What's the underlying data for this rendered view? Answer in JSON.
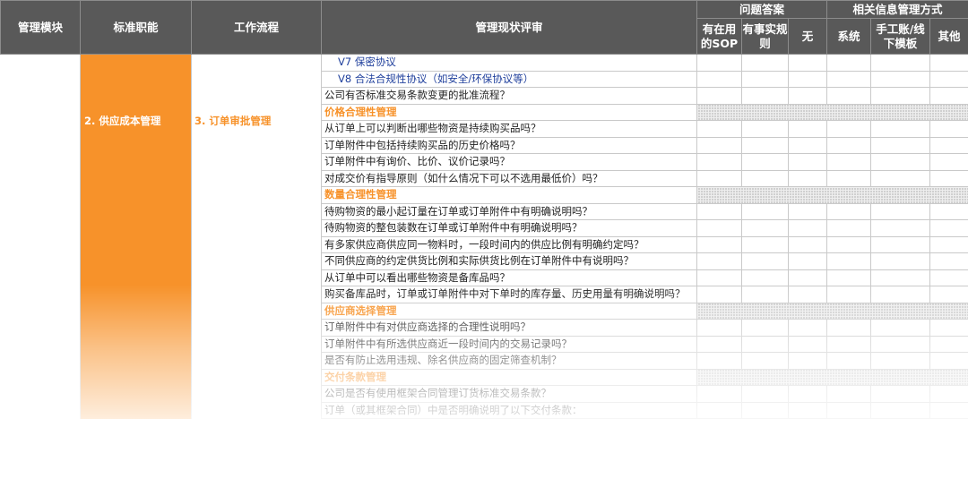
{
  "headers": {
    "module": "管理模块",
    "function": "标准职能",
    "workflow": "工作流程",
    "review": "管理现状评审",
    "answer_group": "问题答案",
    "sop": "有在用的SOP",
    "practical": "有事实规则",
    "none": "无",
    "info_group": "相关信息管理方式",
    "system": "系统",
    "manual": "手工账/线下模板",
    "other": "其他"
  },
  "body": {
    "function_label": "2. 供应成本管理",
    "workflow_label": "3. 订单审批管理"
  },
  "rows": [
    {
      "text": "V7 保密协议",
      "kind": "blue"
    },
    {
      "text": "V8 合法合规性协议（如安全/环保协议等）",
      "kind": "blue"
    },
    {
      "text": "公司有否标准交易条款变更的批准流程？",
      "kind": "item"
    },
    {
      "text": "价格合理性管理",
      "kind": "section"
    },
    {
      "text": "从订单上可以判断出哪些物资是持续购买品吗？",
      "kind": "item"
    },
    {
      "text": "订单附件中包括持续购买品的历史价格吗？",
      "kind": "item"
    },
    {
      "text": "订单附件中有询价、比价、议价记录吗？",
      "kind": "item"
    },
    {
      "text": "对成交价有指导原则（如什么情况下可以不选用最低价）吗？",
      "kind": "item"
    },
    {
      "text": "数量合理性管理",
      "kind": "section"
    },
    {
      "text": "待购物资的最小起订量在订单或订单附件中有明确说明吗？",
      "kind": "item"
    },
    {
      "text": "待购物资的整包装数在订单或订单附件中有明确说明吗？",
      "kind": "item"
    },
    {
      "text": "有多家供应商供应同一物料时，一段时间内的供应比例有明确约定吗？",
      "kind": "item"
    },
    {
      "text": "不同供应商的约定供货比例和实际供货比例在订单附件中有说明吗？",
      "kind": "item"
    },
    {
      "text": "从订单中可以看出哪些物资是备库品吗？",
      "kind": "item"
    },
    {
      "text": "购买备库品时，订单或订单附件中对下单时的库存量、历史用量有明确说明吗？",
      "kind": "wrap"
    },
    {
      "text": "供应商选择管理",
      "kind": "section"
    },
    {
      "text": "订单附件中有对供应商选择的合理性说明吗？",
      "kind": "item"
    },
    {
      "text": "订单附件中有所选供应商近一段时间内的交易记录吗？",
      "kind": "item"
    },
    {
      "text": "是否有防止选用违规、除名供应商的固定筛查机制？",
      "kind": "item"
    },
    {
      "text": "交付条款管理",
      "kind": "section"
    },
    {
      "text": "公司是否有使用框架合同管理订货标准交易条款？",
      "kind": "item"
    },
    {
      "text": "订单（或其框架合同）中是否明确说明了以下交付条款：",
      "kind": "item"
    }
  ],
  "colors": {
    "header_bg": "#595959",
    "accent_orange": "#f7922a",
    "link_blue": "#1f3f9c",
    "grid": "#c9c9c9"
  }
}
